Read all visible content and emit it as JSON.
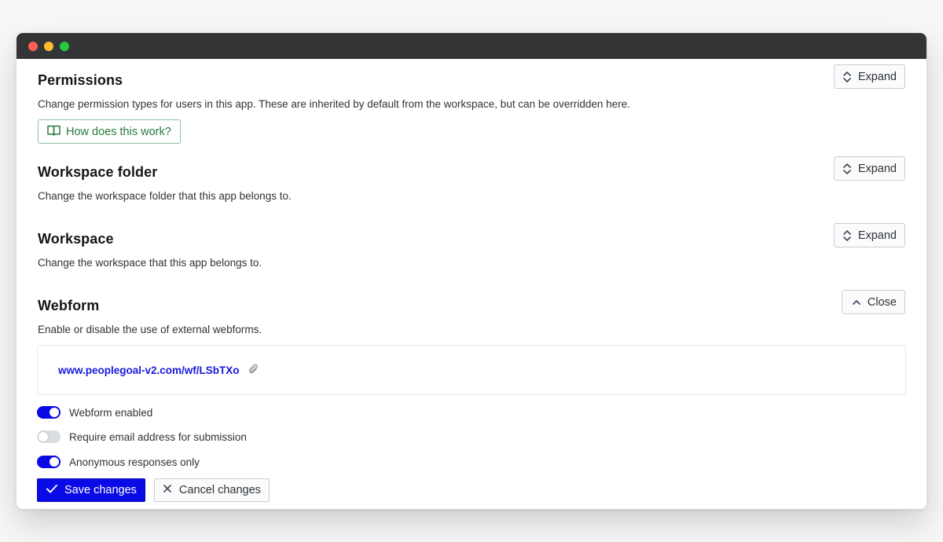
{
  "window": {
    "controls": [
      "close",
      "minimize",
      "maximize"
    ]
  },
  "sections": [
    {
      "title": "Permissions",
      "description": "Change permission types for users in this app. These are inherited by default from the workspace, but can be overridden here.",
      "action_label": "Expand",
      "action_icon": "chevron-up-down-icon",
      "help_label": "How does this work?",
      "help_icon": "book-open-icon"
    },
    {
      "title": "Workspace folder",
      "description": "Change the workspace folder that this app belongs to.",
      "action_label": "Expand",
      "action_icon": "chevron-up-down-icon"
    },
    {
      "title": "Workspace",
      "description": "Change the workspace that this app belongs to.",
      "action_label": "Expand",
      "action_icon": "chevron-up-down-icon"
    },
    {
      "title": "Webform",
      "description": "Enable or disable the use of external webforms.",
      "action_label": "Close",
      "action_icon": "chevron-up-icon"
    }
  ],
  "webform": {
    "url": "www.peoplegoal-v2.com/wf/LSbTXo",
    "url_icon": "paperclip-icon",
    "toggles": [
      {
        "label": "Webform enabled",
        "on": true
      },
      {
        "label": "Require email address for submission",
        "on": false
      },
      {
        "label": "Anonymous responses only",
        "on": true
      }
    ],
    "save_label": "Save changes",
    "cancel_label": "Cancel changes"
  },
  "colors": {
    "primary": "#0a0ae6",
    "help_green": "#2a7a3b",
    "titlebar": "#333436"
  }
}
